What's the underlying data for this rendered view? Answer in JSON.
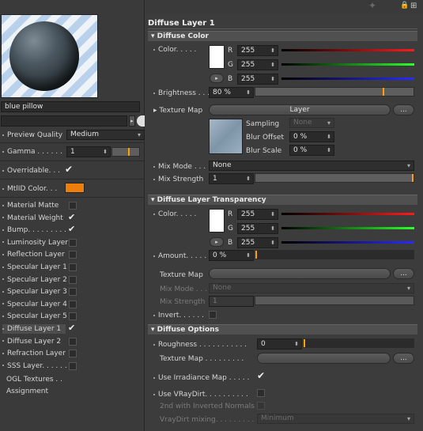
{
  "left": {
    "material_name": "blue pillow",
    "preview_quality_label": "Preview Quality",
    "preview_quality_value": "Medium",
    "gamma_label": "Gamma . . . . . .",
    "gamma_value": "1",
    "overridable_label": "Overridable. . .",
    "mtlid_label": "MtlID Color. . .",
    "mtlid_color": "#ee7e0b",
    "channels": [
      {
        "label": "Material Matte",
        "checked": false
      },
      {
        "label": "Material Weight",
        "checked": true
      },
      {
        "label": "Bump. . . . . . . . .",
        "checked": true
      },
      {
        "label": "Luminosity Layer",
        "checked": false
      },
      {
        "label": "Reflection Layer",
        "checked": false
      },
      {
        "label": "Specular Layer 1",
        "checked": false
      },
      {
        "label": "Specular Layer 2",
        "checked": false
      },
      {
        "label": "Specular Layer 3",
        "checked": false
      },
      {
        "label": "Specular Layer 4",
        "checked": false
      },
      {
        "label": "Specular Layer 5",
        "checked": false
      },
      {
        "label": "Diffuse Layer 1",
        "checked": true
      },
      {
        "label": "Diffuse Layer 2",
        "checked": false
      },
      {
        "label": "Refraction Layer",
        "checked": false
      },
      {
        "label": "SSS Layer. . . . . .",
        "checked": false
      }
    ],
    "ogl_textures": "OGL Textures . .",
    "assignment": "Assignment"
  },
  "right": {
    "panel_title": "Diffuse Layer 1",
    "diffuse_color_header": "Diffuse Color",
    "color_label": "Color. . . . .",
    "r_label": "R",
    "g_label": "G",
    "b_label": "B",
    "r_value": "255",
    "g_value": "255",
    "b_value": "255",
    "brightness_label": "Brightness . . . .",
    "brightness_value": "80 %",
    "brightness_fraction": 0.8,
    "texture_map_label": "Texture Map",
    "layer_button": "Layer",
    "more_button": "...",
    "sampling_label": "Sampling",
    "sampling_value": "None",
    "blur_offset_label": "Blur Offset",
    "blur_offset_value": "0 %",
    "blur_scale_label": "Blur Scale",
    "blur_scale_value": "0 %",
    "mix_mode_label": "Mix Mode . . .",
    "mix_mode_value": "None",
    "mix_strength_label": "Mix Strength",
    "mix_strength_value": "1",
    "transparency_header": "Diffuse Layer Transparency",
    "t_color_label": "Color. . . . .",
    "t_r_value": "255",
    "t_g_value": "255",
    "t_b_value": "255",
    "amount_label": "Amount. . . . . .",
    "amount_value": "0 %",
    "t_texture_map_label": "Texture Map",
    "t_mix_mode_label": "Mix Mode . . .",
    "t_mix_mode_value": "None",
    "t_mix_strength_label": "Mix Strength",
    "t_mix_strength_value": "1",
    "invert_label": "Invert. . . . . .",
    "options_header": "Diffuse Options",
    "roughness_label": "Roughness . . . . . . . . . . .",
    "roughness_value": "0",
    "o_texture_map_label": "Texture Map . . . . . . . . .",
    "irradiance_label": "Use Irradiance Map . . . . .",
    "vraydirt_label": "Use VRayDirt. . . . . . . . . .",
    "inverted_normals_label": "2nd with Inverted Normals",
    "vraydirt_mixing_label": "VrayDirt mixing. . . . . . . . .",
    "vraydirt_mixing_value": "Minimum"
  }
}
